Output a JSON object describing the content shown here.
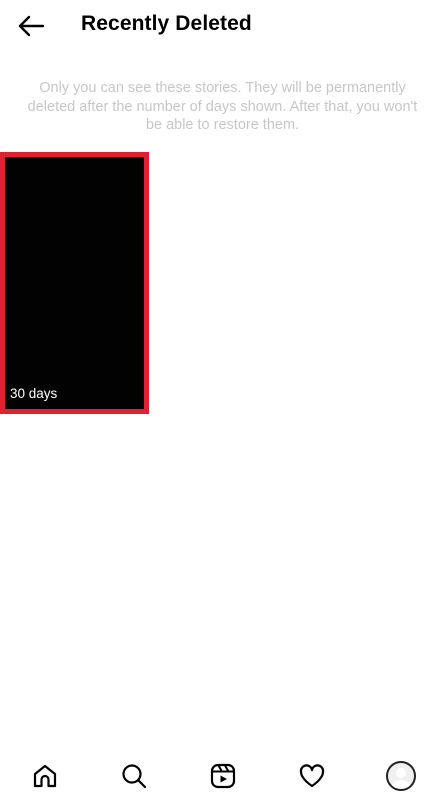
{
  "header": {
    "title": "Recently Deleted",
    "back_icon": "arrow-left-icon"
  },
  "notice": "Only you can see these stories. They will be permanently deleted after the number of days shown. After that, you won't be able to restore them.",
  "stories": [
    {
      "days_label": "30 days"
    }
  ],
  "colors": {
    "highlight_border": "#e0212f",
    "notice_text": "#c7c7c7"
  },
  "bottom_nav": [
    {
      "icon": "home-icon"
    },
    {
      "icon": "search-icon"
    },
    {
      "icon": "reels-icon"
    },
    {
      "icon": "heart-icon"
    },
    {
      "icon": "profile-avatar-icon"
    }
  ]
}
